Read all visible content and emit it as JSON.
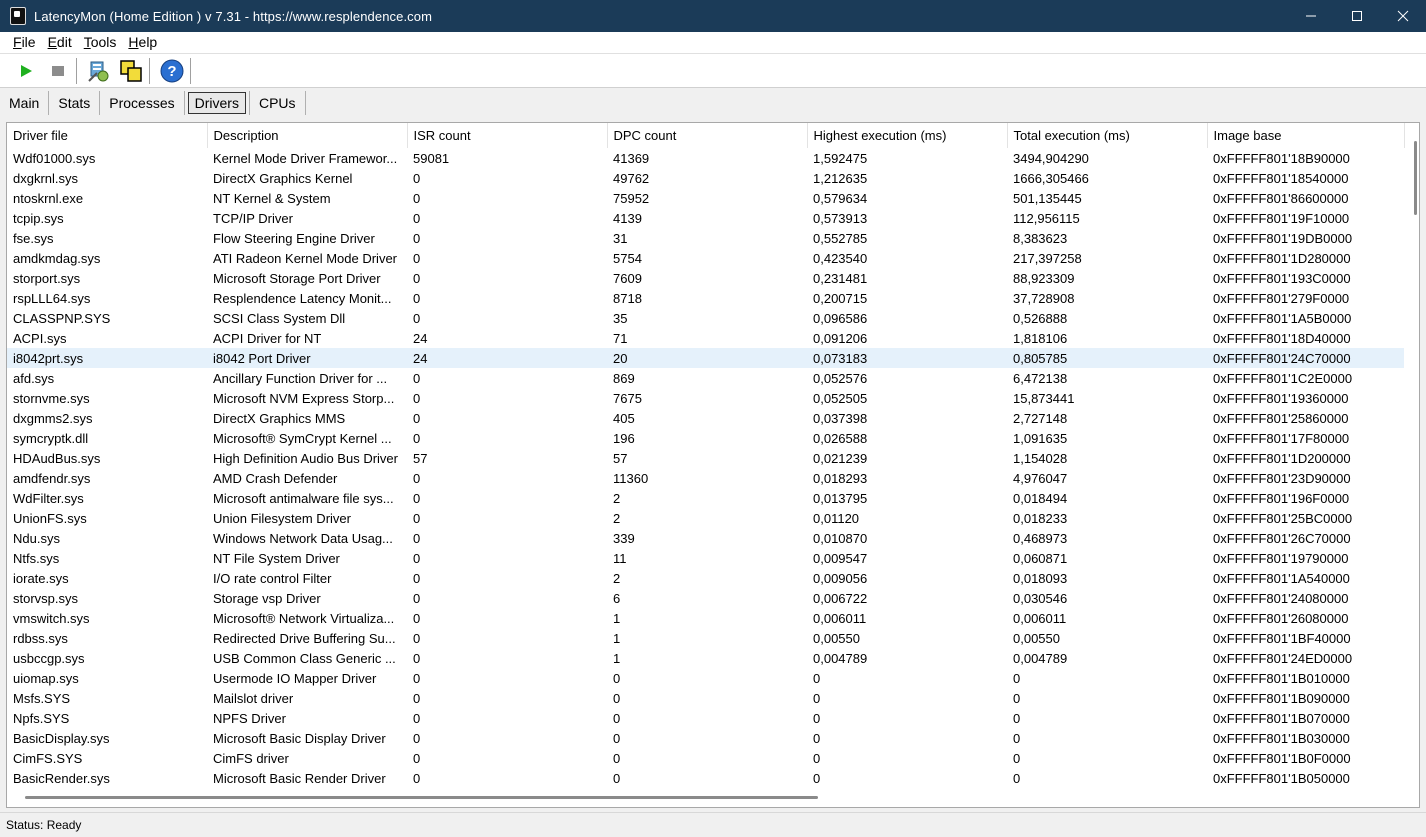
{
  "window": {
    "title": "LatencyMon  (Home Edition )  v 7.31 - https://www.resplendence.com"
  },
  "menu": [
    {
      "key": "F",
      "rest": "ile"
    },
    {
      "key": "E",
      "rest": "dit"
    },
    {
      "key": "T",
      "rest": "ools"
    },
    {
      "key": "H",
      "rest": "elp"
    }
  ],
  "toolbar": {
    "icons": [
      "play-icon",
      "stop-icon",
      "settings-icon",
      "cpu-select-icon",
      "help-icon"
    ]
  },
  "tabs": [
    "Main",
    "Stats",
    "Processes",
    "Drivers",
    "CPUs"
  ],
  "active_tab": "Drivers",
  "table": {
    "columns": [
      "Driver file",
      "Description",
      "ISR count",
      "DPC count",
      "Highest execution (ms)",
      "Total execution (ms)",
      "Image base"
    ],
    "selected_row": 10,
    "rows": [
      [
        "Wdf01000.sys",
        "Kernel Mode Driver Framewor...",
        "59081",
        "41369",
        "1,592475",
        "3494,904290",
        "0xFFFFF801'18B90000"
      ],
      [
        "dxgkrnl.sys",
        "DirectX Graphics Kernel",
        "0",
        "49762",
        "1,212635",
        "1666,305466",
        "0xFFFFF801'18540000"
      ],
      [
        "ntoskrnl.exe",
        "NT Kernel & System",
        "0",
        "75952",
        "0,579634",
        "501,135445",
        "0xFFFFF801'86600000"
      ],
      [
        "tcpip.sys",
        "TCP/IP Driver",
        "0",
        "4139",
        "0,573913",
        "112,956115",
        "0xFFFFF801'19F10000"
      ],
      [
        "fse.sys",
        "Flow Steering Engine Driver",
        "0",
        "31",
        "0,552785",
        "8,383623",
        "0xFFFFF801'19DB0000"
      ],
      [
        "amdkmdag.sys",
        "ATI Radeon Kernel Mode Driver",
        "0",
        "5754",
        "0,423540",
        "217,397258",
        "0xFFFFF801'1D280000"
      ],
      [
        "storport.sys",
        "Microsoft Storage Port Driver",
        "0",
        "7609",
        "0,231481",
        "88,923309",
        "0xFFFFF801'193C0000"
      ],
      [
        "rspLLL64.sys",
        "Resplendence Latency Monit...",
        "0",
        "8718",
        "0,200715",
        "37,728908",
        "0xFFFFF801'279F0000"
      ],
      [
        "CLASSPNP.SYS",
        "SCSI Class System Dll",
        "0",
        "35",
        "0,096586",
        "0,526888",
        "0xFFFFF801'1A5B0000"
      ],
      [
        "ACPI.sys",
        "ACPI Driver for NT",
        "24",
        "71",
        "0,091206",
        "1,818106",
        "0xFFFFF801'18D40000"
      ],
      [
        "i8042prt.sys",
        "i8042 Port Driver",
        "24",
        "20",
        "0,073183",
        "0,805785",
        "0xFFFFF801'24C70000"
      ],
      [
        "afd.sys",
        "Ancillary Function Driver for ...",
        "0",
        "869",
        "0,052576",
        "6,472138",
        "0xFFFFF801'1C2E0000"
      ],
      [
        "stornvme.sys",
        "Microsoft NVM Express Storp...",
        "0",
        "7675",
        "0,052505",
        "15,873441",
        "0xFFFFF801'19360000"
      ],
      [
        "dxgmms2.sys",
        "DirectX Graphics MMS",
        "0",
        "405",
        "0,037398",
        "2,727148",
        "0xFFFFF801'25860000"
      ],
      [
        "symcryptk.dll",
        "Microsoft® SymCrypt Kernel ...",
        "0",
        "196",
        "0,026588",
        "1,091635",
        "0xFFFFF801'17F80000"
      ],
      [
        "HDAudBus.sys",
        "High Definition Audio Bus Driver",
        "57",
        "57",
        "0,021239",
        "1,154028",
        "0xFFFFF801'1D200000"
      ],
      [
        "amdfendr.sys",
        "AMD Crash Defender",
        "0",
        "11360",
        "0,018293",
        "4,976047",
        "0xFFFFF801'23D90000"
      ],
      [
        "WdFilter.sys",
        "Microsoft antimalware file sys...",
        "0",
        "2",
        "0,013795",
        "0,018494",
        "0xFFFFF801'196F0000"
      ],
      [
        "UnionFS.sys",
        "Union Filesystem Driver",
        "0",
        "2",
        "0,01120",
        "0,018233",
        "0xFFFFF801'25BC0000"
      ],
      [
        "Ndu.sys",
        "Windows Network Data Usag...",
        "0",
        "339",
        "0,010870",
        "0,468973",
        "0xFFFFF801'26C70000"
      ],
      [
        "Ntfs.sys",
        "NT File System Driver",
        "0",
        "11",
        "0,009547",
        "0,060871",
        "0xFFFFF801'19790000"
      ],
      [
        "iorate.sys",
        "I/O rate control Filter",
        "0",
        "2",
        "0,009056",
        "0,018093",
        "0xFFFFF801'1A540000"
      ],
      [
        "storvsp.sys",
        "Storage vsp Driver",
        "0",
        "6",
        "0,006722",
        "0,030546",
        "0xFFFFF801'24080000"
      ],
      [
        "vmswitch.sys",
        "Microsoft® Network Virtualiza...",
        "0",
        "1",
        "0,006011",
        "0,006011",
        "0xFFFFF801'26080000"
      ],
      [
        "rdbss.sys",
        "Redirected Drive Buffering Su...",
        "0",
        "1",
        "0,00550",
        "0,00550",
        "0xFFFFF801'1BF40000"
      ],
      [
        "usbccgp.sys",
        "USB Common Class Generic ...",
        "0",
        "1",
        "0,004789",
        "0,004789",
        "0xFFFFF801'24ED0000"
      ],
      [
        "uiomap.sys",
        "Usermode IO Mapper Driver",
        "0",
        "0",
        "0",
        "0",
        "0xFFFFF801'1B010000"
      ],
      [
        "Msfs.SYS",
        "Mailslot driver",
        "0",
        "0",
        "0",
        "0",
        "0xFFFFF801'1B090000"
      ],
      [
        "Npfs.SYS",
        "NPFS Driver",
        "0",
        "0",
        "0",
        "0",
        "0xFFFFF801'1B070000"
      ],
      [
        "BasicDisplay.sys",
        "Microsoft Basic Display Driver",
        "0",
        "0",
        "0",
        "0",
        "0xFFFFF801'1B030000"
      ],
      [
        "CimFS.SYS",
        "CimFS driver",
        "0",
        "0",
        "0",
        "0",
        "0xFFFFF801'1B0F0000"
      ],
      [
        "BasicRender.sys",
        "Microsoft Basic Render Driver",
        "0",
        "0",
        "0",
        "0",
        "0xFFFFF801'1B050000"
      ]
    ]
  },
  "status": "Status: Ready"
}
